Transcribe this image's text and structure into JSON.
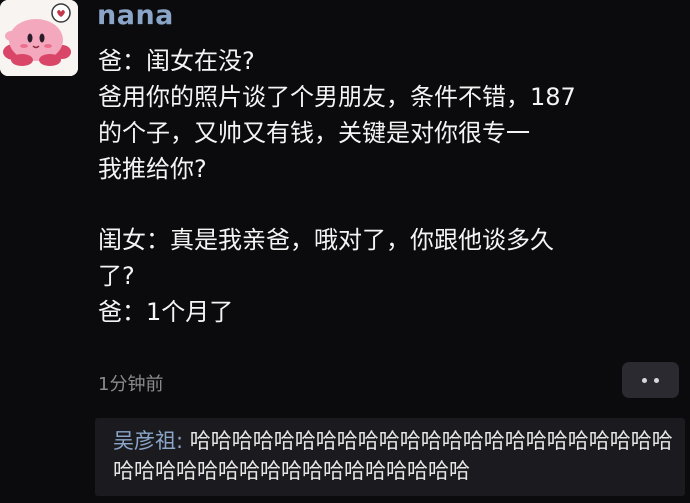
{
  "post": {
    "username": "nana",
    "avatar_icon": "pink-kirby-avatar-icon",
    "lines": [
      "爸：闺女在没?",
      "爸用你的照片谈了个男朋友，条件不错，187",
      "的个子，又帅又有钱，关键是对你很专一",
      "我推给你?",
      "",
      "闺女：真是我亲爸，哦对了，你跟他谈多久",
      "了?",
      "爸：1个月了"
    ],
    "timestamp": "1分钟前",
    "more_icon": "more-dots-icon"
  },
  "comment": {
    "author": "吴彦祖",
    "separator": ":",
    "text": " 哈哈哈哈哈哈哈哈哈哈哈哈哈哈哈哈哈哈哈哈哈哈哈哈哈哈哈哈哈哈哈哈哈哈哈哈哈哈哈哈"
  },
  "colors": {
    "background": "#0b0b0d",
    "accent_name": "#8aa5c8",
    "comment_bg": "#1b1b1f",
    "muted_text": "#8a8a8f"
  }
}
